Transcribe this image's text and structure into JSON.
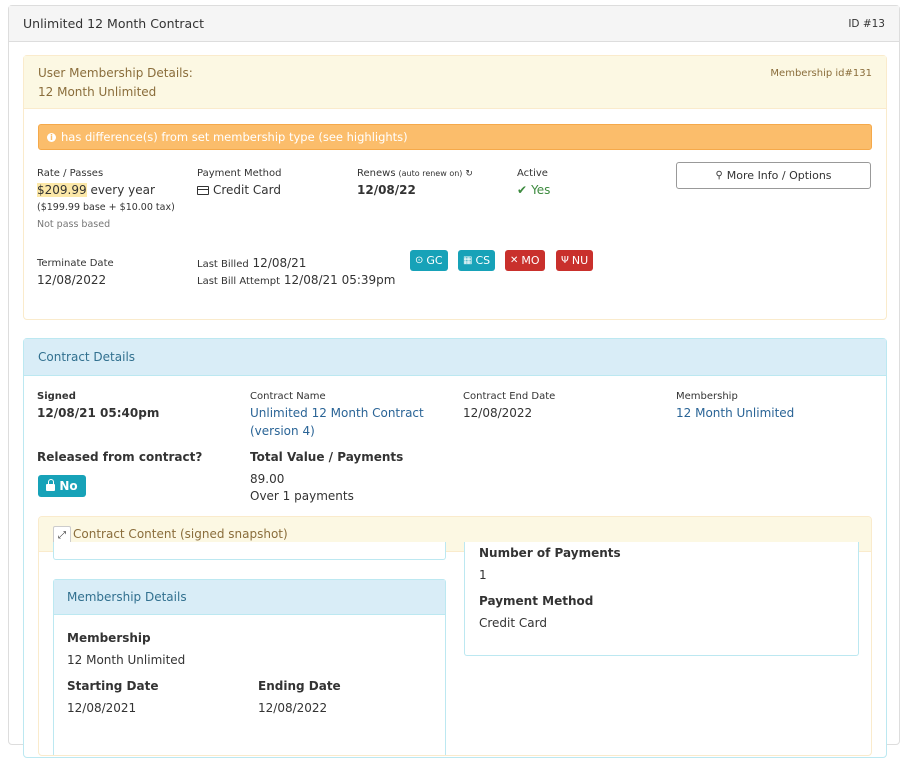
{
  "header": {
    "title": "Unlimited 12 Month Contract",
    "id_label": "ID #13"
  },
  "user_membership": {
    "heading": "User Membership Details:",
    "name": "12 Month Unlimited",
    "membership_id": "Membership id#131",
    "alert": "has difference(s) from set membership type (see highlights)",
    "rate": {
      "label": "Rate / Passes",
      "amount": "$209.99",
      "period": " every year",
      "breakdown": "($199.99 base + $10.00 tax)",
      "pass_note": "Not pass based"
    },
    "payment": {
      "label": "Payment Method",
      "value": "Credit Card"
    },
    "renews": {
      "label": "Renews",
      "note": "(auto renew on)",
      "value": "12/08/22"
    },
    "active": {
      "label": "Active",
      "value": "Yes"
    },
    "more_button": "More Info / Options",
    "terminate": {
      "label": "Terminate Date",
      "value": "12/08/2022"
    },
    "last_billed": {
      "label": "Last Billed",
      "value": "12/08/21"
    },
    "last_attempt": {
      "label": "Last Bill Attempt",
      "value": "12/08/21 05:39pm"
    },
    "tags": [
      {
        "label": "GC",
        "icon": "check-circle-icon",
        "color": "#17a2b8"
      },
      {
        "label": "CS",
        "icon": "calendar-icon",
        "color": "#17a2b8"
      },
      {
        "label": "MO",
        "icon": "arrows-icon",
        "color": "#c9302c"
      },
      {
        "label": "NU",
        "icon": "utensils-icon",
        "color": "#c9302c"
      }
    ]
  },
  "contract": {
    "heading": "Contract Details",
    "signed": {
      "label": "Signed",
      "value": "12/08/21 05:40pm"
    },
    "contract_name": {
      "label": "Contract Name",
      "value": "Unlimited 12 Month Contract",
      "version": "(version 4)"
    },
    "end_date": {
      "label": "Contract End Date",
      "value": "12/08/2022"
    },
    "membership": {
      "label": "Membership",
      "value": "12 Month Unlimited"
    },
    "released": {
      "label": "Released from contract?",
      "value": "No"
    },
    "total": {
      "label": "Total Value / Payments",
      "value": "89.00",
      "payments": "Over 1 payments"
    },
    "snapshot": {
      "heading": "Contract Content (signed snapshot)",
      "number_of_payments": {
        "label": "Number of Payments",
        "value": "1"
      },
      "payment_method": {
        "label": "Payment Method",
        "value": "Credit Card"
      },
      "membership_details": {
        "heading": "Membership Details",
        "membership": {
          "label": "Membership",
          "value": "12 Month Unlimited"
        },
        "starting": {
          "label": "Starting Date",
          "value": "12/08/2021"
        },
        "ending": {
          "label": "Ending Date",
          "value": "12/08/2022"
        }
      }
    }
  }
}
